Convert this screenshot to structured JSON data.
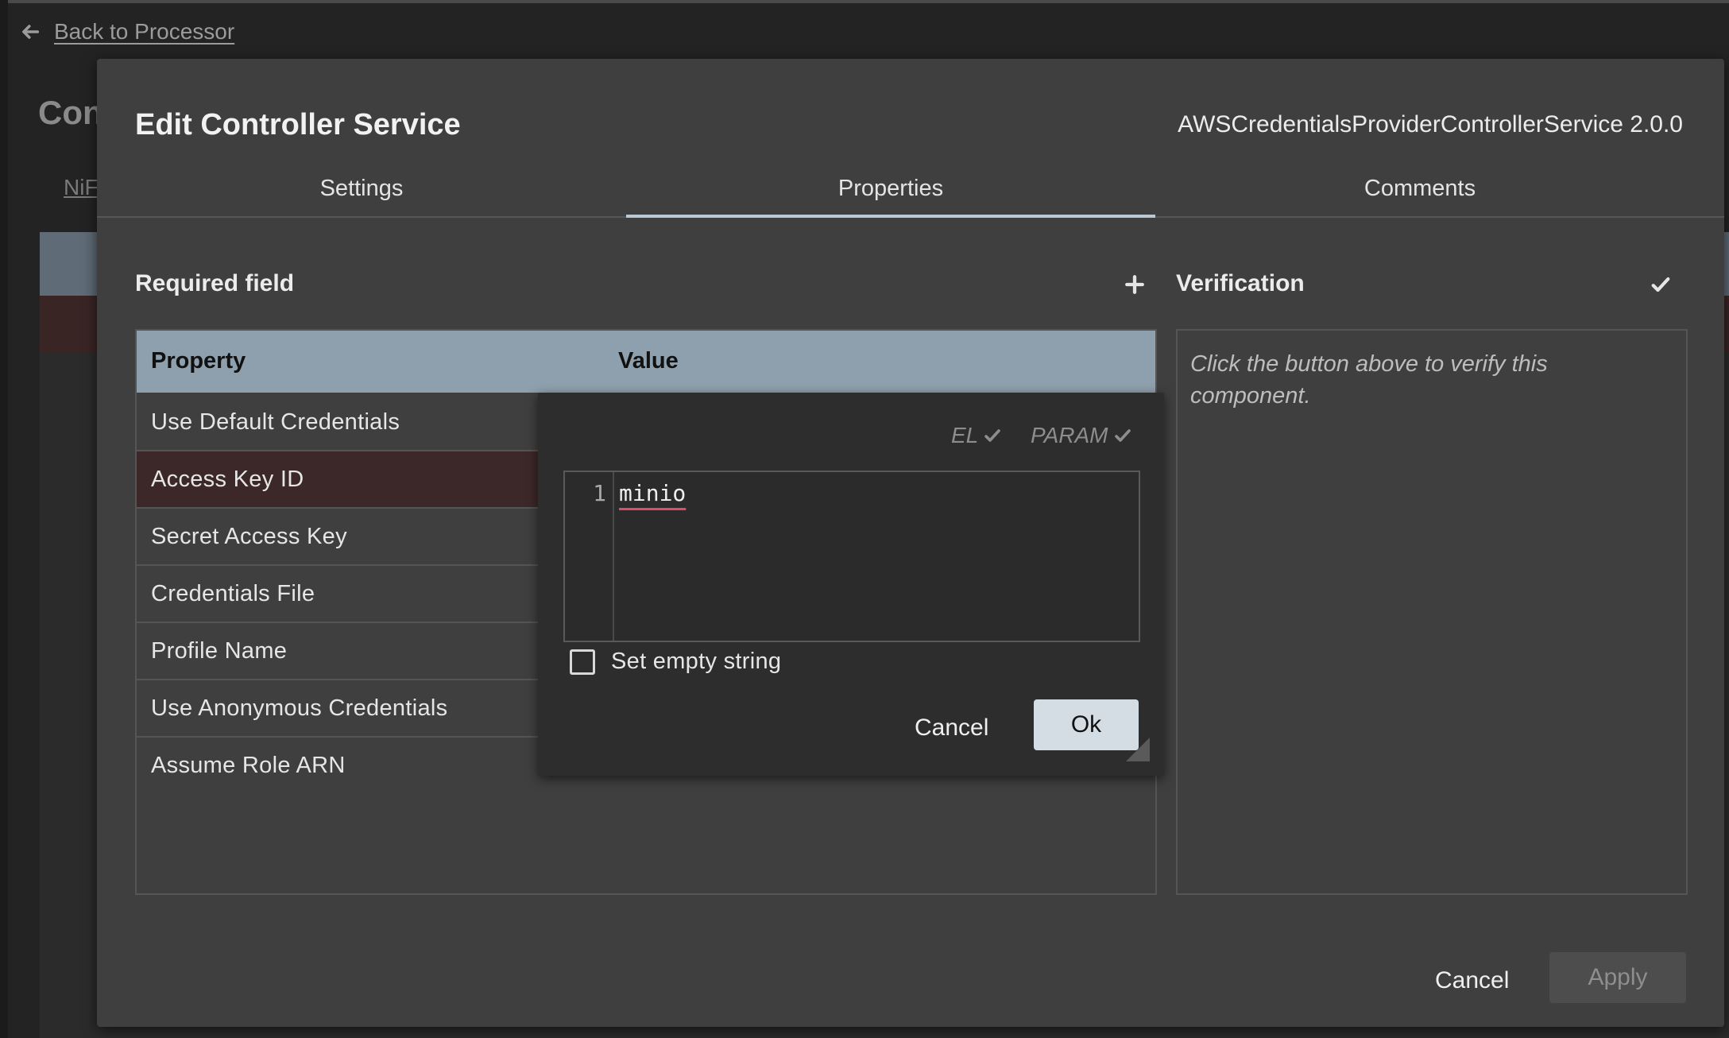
{
  "background": {
    "back_link": "Back to Processor",
    "title": "Con",
    "tab": "NiF"
  },
  "dialog": {
    "title": "Edit Controller Service",
    "subtitle": "AWSCredentialsProviderControllerService 2.0.0",
    "tabs": [
      {
        "label": "Settings",
        "active": false
      },
      {
        "label": "Properties",
        "active": true
      },
      {
        "label": "Comments",
        "active": false
      }
    ],
    "required_label": "Required field",
    "verification_label": "Verification",
    "verification_text": "Click the button above to verify this component.",
    "table": {
      "headers": {
        "property": "Property",
        "value": "Value"
      },
      "rows": [
        {
          "name": "Use Default Credentials",
          "selected": false
        },
        {
          "name": "Access Key ID",
          "selected": true
        },
        {
          "name": "Secret Access Key",
          "selected": false
        },
        {
          "name": "Credentials File",
          "selected": false
        },
        {
          "name": "Profile Name",
          "selected": false
        },
        {
          "name": "Use Anonymous Credentials",
          "selected": false
        },
        {
          "name": "Assume Role ARN",
          "selected": false
        }
      ]
    },
    "cancel_label": "Cancel",
    "apply_label": "Apply"
  },
  "editor_popup": {
    "el_label": "EL",
    "param_label": "PARAM",
    "line_number": "1",
    "value": "minio",
    "empty_string_label": "Set empty string",
    "empty_string_checked": false,
    "cancel_label": "Cancel",
    "ok_label": "Ok"
  },
  "colors": {
    "table_header": "#8ea0ad",
    "selected_row": "#3c2828",
    "ok_button": "#d4dde3",
    "tab_indicator": "#b9cad6"
  }
}
